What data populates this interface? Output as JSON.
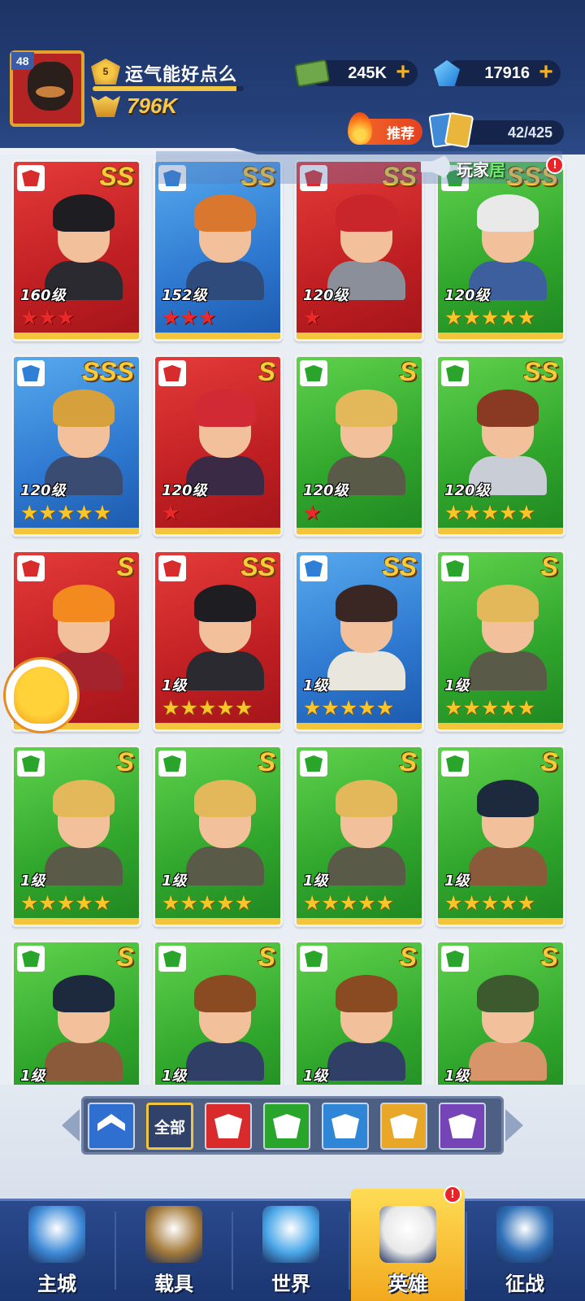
{
  "player": {
    "level": "48",
    "rank": "5",
    "name": "运气能好点么",
    "xp_fraction": 0.95,
    "power": "796K"
  },
  "resources": {
    "cash": "245K",
    "gems": "17916",
    "cash_plus": "+",
    "gems_plus": "+"
  },
  "header": {
    "recommend_label": "推荐",
    "card_count": "42/425"
  },
  "ticker": {
    "prefix": "玩家",
    "highlight": "居",
    "alert": "!"
  },
  "heroes": [
    {
      "grade": "SS",
      "color": "red",
      "level": "160级",
      "stars": 3,
      "star_color": "red",
      "hair": "#1e1e22",
      "body": "#2a2a30"
    },
    {
      "grade": "SS",
      "color": "blue",
      "level": "152级",
      "stars": 3,
      "star_color": "red",
      "hair": "#d9772e",
      "body": "#2f4b7c"
    },
    {
      "grade": "SS",
      "color": "red",
      "level": "120级",
      "stars": 1,
      "star_color": "red",
      "hair": "#c8262b",
      "body": "#8a8f99"
    },
    {
      "grade": "SSS",
      "color": "green",
      "level": "120级",
      "stars": 5,
      "star_color": "gold",
      "hair": "#e9e9e9",
      "body": "#3d5f9e"
    },
    {
      "grade": "SSS",
      "color": "blue",
      "level": "120级",
      "stars": 5,
      "star_color": "gold",
      "hair": "#d6a13c",
      "body": "#3a4c72"
    },
    {
      "grade": "S",
      "color": "red",
      "level": "120级",
      "stars": 1,
      "star_color": "red",
      "hair": "#d22a35",
      "body": "#3a2a45"
    },
    {
      "grade": "S",
      "color": "green",
      "level": "120级",
      "stars": 1,
      "star_color": "red",
      "hair": "#e2b85a",
      "body": "#5a5a48"
    },
    {
      "grade": "SS",
      "color": "green",
      "level": "120级",
      "stars": 5,
      "star_color": "gold",
      "hair": "#8a3a22",
      "body": "#c9cdd6"
    },
    {
      "grade": "S",
      "color": "red",
      "level": "",
      "stars": 1,
      "star_color": "red",
      "hair": "#f28a20",
      "body": "#a4232c"
    },
    {
      "grade": "SS",
      "color": "red",
      "level": "1级",
      "stars": 5,
      "star_color": "gold",
      "hair": "#1e1e22",
      "body": "#2a2a30"
    },
    {
      "grade": "SS",
      "color": "blue",
      "level": "1级",
      "stars": 5,
      "star_color": "gold",
      "hair": "#3a2622",
      "body": "#e9e6de"
    },
    {
      "grade": "S",
      "color": "green",
      "level": "1级",
      "stars": 5,
      "star_color": "gold",
      "hair": "#e2b85a",
      "body": "#5a5a48"
    },
    {
      "grade": "S",
      "color": "green",
      "level": "1级",
      "stars": 5,
      "star_color": "gold",
      "hair": "#e2b85a",
      "body": "#5a5a48"
    },
    {
      "grade": "S",
      "color": "green",
      "level": "1级",
      "stars": 5,
      "star_color": "gold",
      "hair": "#e2b85a",
      "body": "#5a5a48"
    },
    {
      "grade": "S",
      "color": "green",
      "level": "1级",
      "stars": 5,
      "star_color": "gold",
      "hair": "#e2b85a",
      "body": "#5a5a48"
    },
    {
      "grade": "S",
      "color": "green",
      "level": "1级",
      "stars": 5,
      "star_color": "gold",
      "hair": "#1d2a3e",
      "body": "#8a5a3a"
    },
    {
      "grade": "S",
      "color": "green",
      "level": "1级",
      "stars": 0,
      "star_color": "gold",
      "hair": "#1d2a3e",
      "body": "#8a5a3a"
    },
    {
      "grade": "S",
      "color": "green",
      "level": "1级",
      "stars": 0,
      "star_color": "gold",
      "hair": "#8a4a22",
      "body": "#2f3f66"
    },
    {
      "grade": "S",
      "color": "green",
      "level": "1级",
      "stars": 0,
      "star_color": "gold",
      "hair": "#8a4a22",
      "body": "#2f3f66"
    },
    {
      "grade": "S",
      "color": "green",
      "level": "1级",
      "stars": 0,
      "star_color": "gold",
      "hair": "#3d5a2e",
      "body": "#d8956a"
    }
  ],
  "filters": [
    {
      "name": "filter-sort-tab",
      "label": "",
      "color": "#2f6fd0",
      "icon": "chevron-up-icon",
      "selected": false
    },
    {
      "name": "filter-all-tab",
      "label": "全部",
      "color": "#30416a",
      "icon": "",
      "selected": true
    },
    {
      "name": "filter-red-tab",
      "label": "",
      "color": "#d92b2b",
      "icon": "shield-star-icon",
      "selected": false
    },
    {
      "name": "filter-green-tab",
      "label": "",
      "color": "#2aa52c",
      "icon": "eagle-icon",
      "selected": false
    },
    {
      "name": "filter-blue-tab",
      "label": "",
      "color": "#2f86d6",
      "icon": "fortress-icon",
      "selected": false
    },
    {
      "name": "filter-gold-tab",
      "label": "",
      "color": "#e9a72a",
      "icon": "dna-icon",
      "selected": false
    },
    {
      "name": "filter-purple-tab",
      "label": "",
      "color": "#7545b8",
      "icon": "eye-triangle-icon",
      "selected": false
    }
  ],
  "nav": [
    {
      "label": "主城",
      "icon": "mech-base-icon",
      "active": false,
      "color": "#3f8bd8"
    },
    {
      "label": "载具",
      "icon": "robot-icon",
      "active": false,
      "color": "#a47a3a"
    },
    {
      "label": "世界",
      "icon": "globe-icon",
      "active": false,
      "color": "#4aa7e8"
    },
    {
      "label": "英雄",
      "icon": "hero-helmet-icon",
      "active": true,
      "color": "#e8e8e8"
    },
    {
      "label": "征战",
      "icon": "radar-icon",
      "active": false,
      "color": "#2e6fb7"
    }
  ],
  "nav_alert": "!"
}
